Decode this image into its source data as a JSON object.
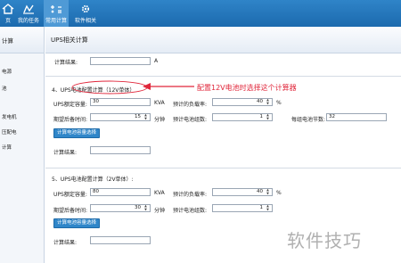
{
  "toolbar": {
    "items": [
      {
        "label": "页",
        "icon": "home-icon"
      },
      {
        "label": "我的任务",
        "icon": "task-icon"
      },
      {
        "label": "常用计算",
        "icon": "calculator-icon",
        "active": true
      },
      {
        "label": "软件相关",
        "icon": "gear-icon"
      }
    ]
  },
  "sidebar": {
    "header": "计算",
    "items": [
      "电源",
      "池",
      "发电机",
      "压配电",
      "计算"
    ]
  },
  "page": {
    "title": "UPS相关计算",
    "top_result": {
      "label": "计算结果:",
      "value": "",
      "unit": "A"
    },
    "section4": {
      "title": "4、UPS电池配置计算（12V单体）",
      "rated_capacity": {
        "label": "UPS额定容量:",
        "value": "30",
        "unit": "KVA"
      },
      "load_rate": {
        "label": "预计的负载率:",
        "value": "40",
        "unit": "%"
      },
      "backup_time": {
        "label": "期望后备时间:",
        "value": "15",
        "unit": "分钟"
      },
      "battery_groups": {
        "label": "预计电池组数:",
        "value": "1"
      },
      "cells_per_group": {
        "label": "每组电池节数:",
        "value": "32"
      },
      "button": "计算电池容量选择",
      "result": {
        "label": "计算结果:",
        "value": ""
      }
    },
    "section5": {
      "title": "5、UPS电池配置计算（2V单体）:",
      "rated_capacity": {
        "label": "UPS额定容量:",
        "value": "80",
        "unit": "KVA"
      },
      "load_rate": {
        "label": "预计的负载率:",
        "value": "40",
        "unit": "%"
      },
      "backup_time": {
        "label": "期望后备时间:",
        "value": "30",
        "unit": "分钟"
      },
      "battery_groups": {
        "label": "预计电池组数:",
        "value": "1"
      },
      "button": "计算电池容量选择",
      "result": {
        "label": "计算结果:",
        "value": ""
      }
    }
  },
  "annotation": {
    "text": "配置12V电池时选择这个计算器",
    "color": "#e0263a"
  },
  "watermark": "软件技巧",
  "colors": {
    "toolbar": "#1c6aae",
    "button": "#2f86c9",
    "annotation": "#e0263a"
  }
}
